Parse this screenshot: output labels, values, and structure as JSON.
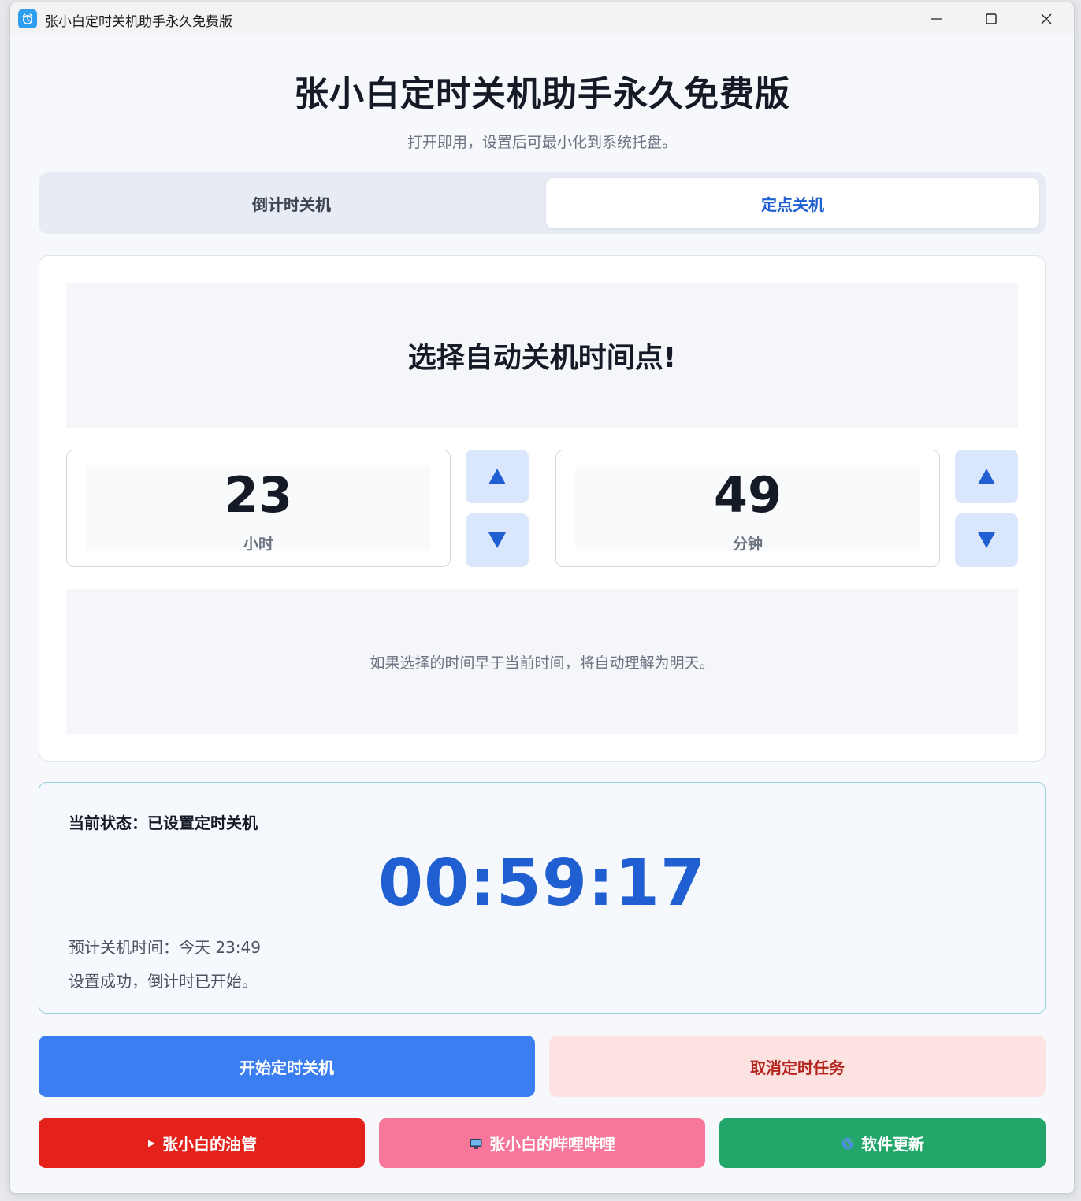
{
  "window": {
    "title": "张小白定时关机助手永久免费版",
    "icon": "alarm-clock-icon"
  },
  "header": {
    "title": "张小白定时关机助手永久免费版",
    "subtitle": "打开即用，设置后可最小化到系统托盘。"
  },
  "tabs": [
    {
      "label": "倒计时关机",
      "active": false
    },
    {
      "label": "定点关机",
      "active": true
    }
  ],
  "schedule": {
    "banner": "选择自动关机时间点!",
    "hour": {
      "value": "23",
      "unit": "小时"
    },
    "minute": {
      "value": "49",
      "unit": "分钟"
    },
    "hint": "如果选择的时间早于当前时间，将自动理解为明天。"
  },
  "status": {
    "line": "当前状态：已设置定时关机",
    "countdown": "00:59:17",
    "expected": "预计关机时间：今天 23:49",
    "message": "设置成功，倒计时已开始。"
  },
  "actions": {
    "start_label": "开始定时关机",
    "cancel_label": "取消定时任务"
  },
  "links": {
    "youtube_label": "张小白的油管",
    "bilibili_label": "张小白的哔哩哔哩",
    "update_label": "软件更新"
  },
  "colors": {
    "accent": "#1f5fd1",
    "start": "#3a7ef2",
    "cancel_bg": "#fde2e2",
    "youtube": "#e4211b",
    "bilibili": "#f7779b",
    "update": "#22a66a"
  }
}
